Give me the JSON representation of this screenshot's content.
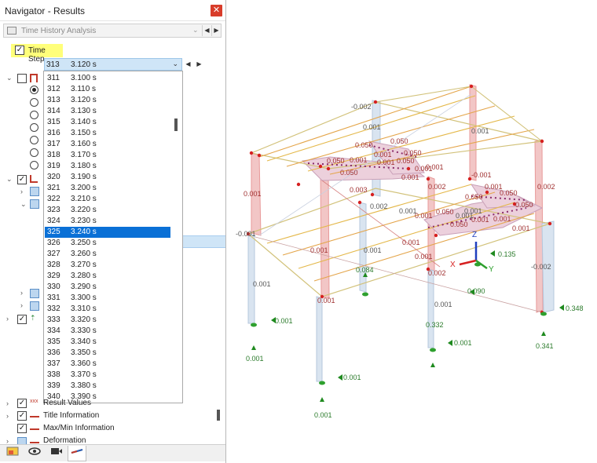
{
  "window": {
    "title": "Navigator - Results",
    "close": "✕"
  },
  "mode": {
    "label": "Time History Analysis",
    "dropdown": "⌄",
    "prev": "◀",
    "next": "▶"
  },
  "time_step": {
    "label": "Time Step",
    "checked": "✓"
  },
  "selector": {
    "step": "313",
    "time": "3.120 s",
    "dropdown": "⌄",
    "prev": "◀",
    "next": "▶"
  },
  "steps": [
    {
      "n": "311",
      "t": "3.100 s"
    },
    {
      "n": "312",
      "t": "3.110 s"
    },
    {
      "n": "313",
      "t": "3.120 s"
    },
    {
      "n": "314",
      "t": "3.130 s"
    },
    {
      "n": "315",
      "t": "3.140 s"
    },
    {
      "n": "316",
      "t": "3.150 s"
    },
    {
      "n": "317",
      "t": "3.160 s"
    },
    {
      "n": "318",
      "t": "3.170 s"
    },
    {
      "n": "319",
      "t": "3.180 s"
    },
    {
      "n": "320",
      "t": "3.190 s"
    },
    {
      "n": "321",
      "t": "3.200 s"
    },
    {
      "n": "322",
      "t": "3.210 s"
    },
    {
      "n": "323",
      "t": "3.220 s"
    },
    {
      "n": "324",
      "t": "3.230 s"
    },
    {
      "n": "325",
      "t": "3.240 s"
    },
    {
      "n": "326",
      "t": "3.250 s"
    },
    {
      "n": "327",
      "t": "3.260 s"
    },
    {
      "n": "328",
      "t": "3.270 s"
    },
    {
      "n": "329",
      "t": "3.280 s"
    },
    {
      "n": "330",
      "t": "3.290 s"
    },
    {
      "n": "331",
      "t": "3.300 s"
    },
    {
      "n": "332",
      "t": "3.310 s"
    },
    {
      "n": "333",
      "t": "3.320 s"
    },
    {
      "n": "334",
      "t": "3.330 s"
    },
    {
      "n": "335",
      "t": "3.340 s"
    },
    {
      "n": "336",
      "t": "3.350 s"
    },
    {
      "n": "337",
      "t": "3.360 s"
    },
    {
      "n": "338",
      "t": "3.370 s"
    },
    {
      "n": "339",
      "t": "3.380 s"
    },
    {
      "n": "340",
      "t": "3.390 s"
    }
  ],
  "selected_step": "325",
  "bottom_items": [
    {
      "label": "Result Values",
      "checked": "✓"
    },
    {
      "label": "Title Information",
      "checked": "✓"
    },
    {
      "label": "Max/Min Information",
      "checked": "✓"
    },
    {
      "label": "Deformation",
      "checked": ""
    }
  ],
  "tabs": [
    {
      "icon": "data-icon"
    },
    {
      "icon": "eye-icon"
    },
    {
      "icon": "camera-icon"
    },
    {
      "icon": "results-icon"
    }
  ],
  "model_labels": {
    "top": [
      "-0.002",
      "0.001",
      "0.001",
      "0.002",
      "0.001",
      "0.001",
      "0.001"
    ],
    "roof": [
      "0.050",
      "0.050",
      "0.050",
      "0.001",
      "0.050",
      "0.050",
      "0.001",
      "0.001",
      "0.050",
      "0.001",
      "0.001",
      "0.001",
      "0.050",
      "0.050",
      "0.050",
      "0.001",
      "0.001",
      "0.002",
      "0.003",
      "0.050",
      "0.050",
      "0.001"
    ],
    "mid": [
      "0.002",
      "0.001",
      "0.001",
      "0.001",
      "0.001",
      "0.001",
      "0.002",
      "0.001",
      "0.001",
      "-0.001",
      "-0.002",
      "0.001",
      "0.084",
      "0.001",
      "0.001",
      "-0.001"
    ],
    "supports": [
      "0.001",
      "0.001",
      "0.001",
      "0.001",
      "0.332",
      "0.001",
      "0.348",
      "0.341",
      "0.090",
      "0.135"
    ],
    "axes": {
      "x": "X",
      "y": "Y",
      "z": "Z"
    }
  }
}
